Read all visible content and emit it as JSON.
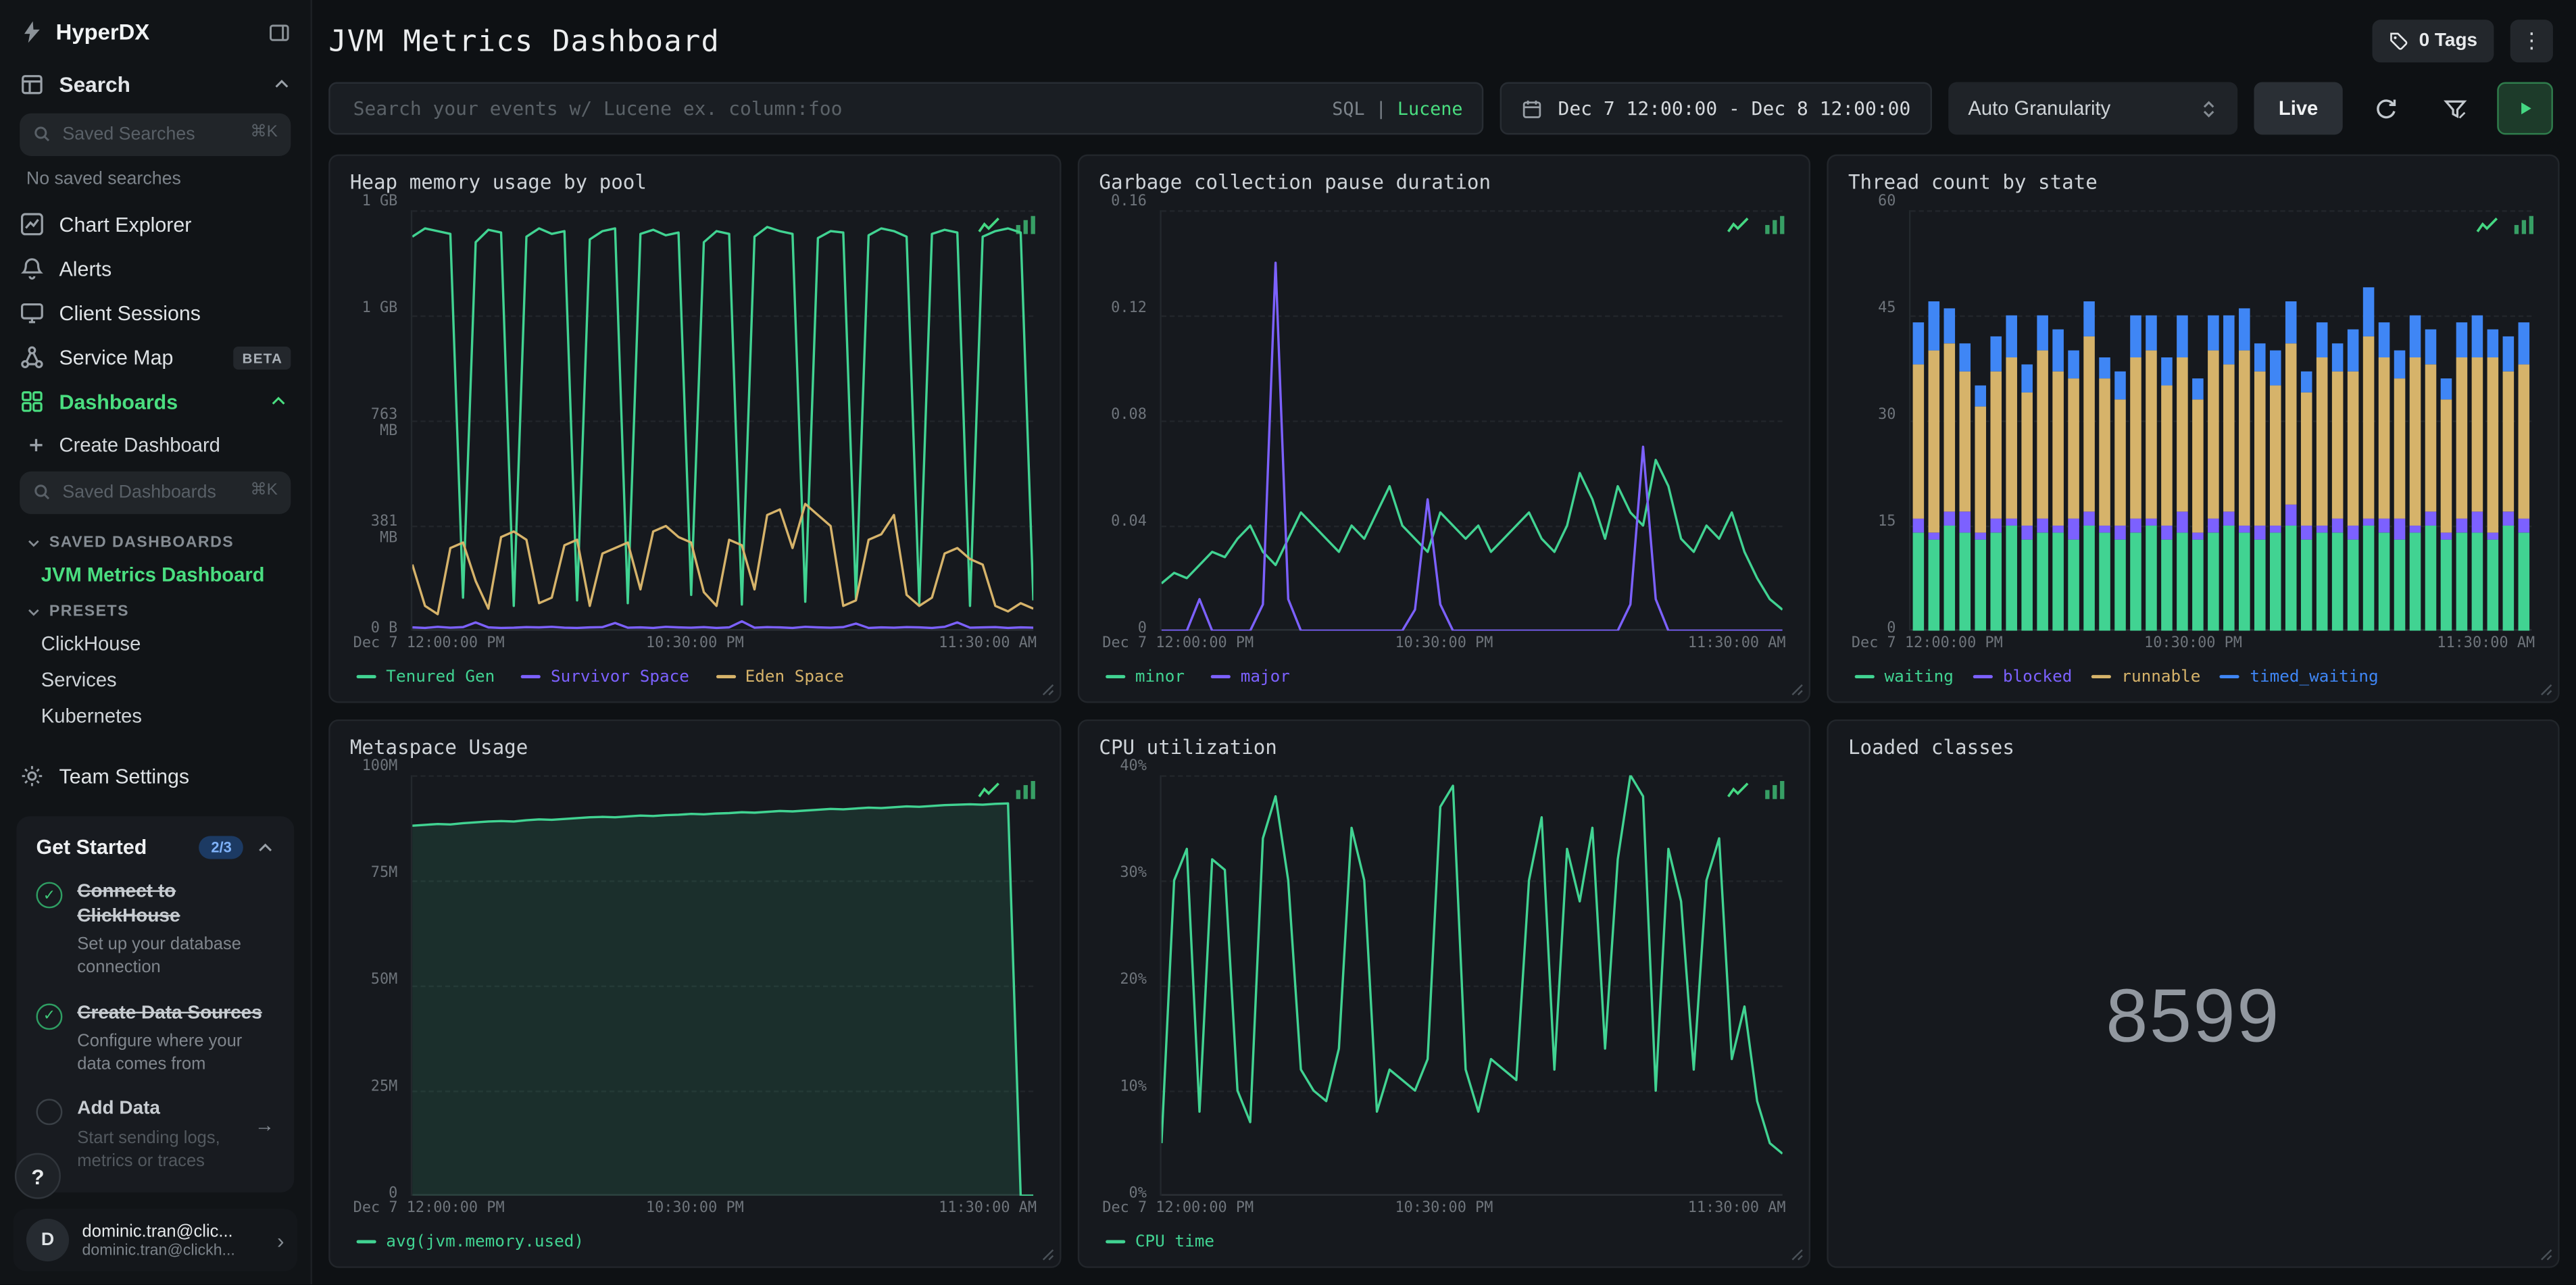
{
  "colors": {
    "accent_green": "#4ade80",
    "series_green": "#41d392",
    "series_purple": "#7c61ff",
    "series_yellow": "#d6b36a",
    "series_blue": "#3f86f5"
  },
  "sidebar": {
    "brand": "HyperDX",
    "search_section_label": "Search",
    "saved_searches": {
      "placeholder": "Saved Searches",
      "shortcut": "⌘K"
    },
    "no_saved_searches": "No saved searches",
    "nav": [
      {
        "label": "Chart Explorer"
      },
      {
        "label": "Alerts"
      },
      {
        "label": "Client Sessions"
      },
      {
        "label": "Service Map",
        "badge": "BETA"
      },
      {
        "label": "Dashboards"
      }
    ],
    "create_dashboard_label": "Create Dashboard",
    "saved_dashboards_input": {
      "placeholder": "Saved Dashboards",
      "shortcut": "⌘K"
    },
    "saved_dashboards_section": "SAVED DASHBOARDS",
    "saved_dashboards": [
      {
        "label": "JVM Metrics Dashboard"
      }
    ],
    "presets_section": "PRESETS",
    "presets": [
      {
        "label": "ClickHouse"
      },
      {
        "label": "Services"
      },
      {
        "label": "Kubernetes"
      }
    ],
    "team_settings_label": "Team Settings",
    "get_started": {
      "title": "Get Started",
      "progress": "2/3",
      "items": [
        {
          "title": "Connect to ClickHouse",
          "subtitle": "Set up your database connection"
        },
        {
          "title": "Create Data Sources",
          "subtitle": "Configure where your data comes from"
        },
        {
          "title": "Add Data",
          "subtitle": "Start sending logs, metrics or traces",
          "arrow": "→"
        }
      ]
    },
    "help_label": "?",
    "user": {
      "initial": "D",
      "name": "dominic.tran@clic...",
      "email": "dominic.tran@clickh...",
      "chevron": "›"
    }
  },
  "header": {
    "title": "JVM Metrics Dashboard",
    "tags_label": "0 Tags",
    "menu_icon": "⋮"
  },
  "toolbar": {
    "search_placeholder": "Search your events w/ Lucene ex. column:foo",
    "mode_sql": "SQL",
    "mode_divider": "|",
    "mode_lucene": "Lucene",
    "date_range": "Dec 7 12:00:00 - Dec 8 12:00:00",
    "granularity": "Auto Granularity",
    "live_label": "Live"
  },
  "chart_data": [
    {
      "id": "heap",
      "title": "Heap memory usage by pool",
      "type": "line",
      "ylim": [
        0,
        1525.9
      ],
      "yticks": [
        {
          "label": "0 B",
          "value": 0
        },
        {
          "label": "381 MB",
          "value": 381.5
        },
        {
          "label": "763 MB",
          "value": 763
        },
        {
          "label": "1 GB",
          "value": 1144.4
        },
        {
          "label": "1 GB",
          "value": 1525.9
        }
      ],
      "x_labels": [
        "Dec 7 12:00:00 PM",
        "10:30:00 PM",
        "11:30:00 AM"
      ],
      "series": [
        {
          "name": "Tenured Gen",
          "color": "#41d392",
          "values": [
            1430,
            1460,
            1450,
            1440,
            120,
            1410,
            1455,
            1445,
            90,
            1430,
            1460,
            1440,
            1450,
            110,
            1420,
            1450,
            1460,
            100,
            1440,
            1455,
            1435,
            1445,
            130,
            1410,
            1450,
            1440,
            95,
            1430,
            1465,
            1450,
            1440,
            105,
            1425,
            1450,
            1445,
            115,
            1435,
            1460,
            1450,
            1430,
            100,
            1440,
            1455,
            1445,
            90,
            1430,
            1450,
            1460,
            1445,
            110
          ]
        },
        {
          "name": "Survivor Space",
          "color": "#7c61ff",
          "values": [
            12,
            10,
            14,
            11,
            13,
            30,
            12,
            10,
            11,
            13,
            12,
            14,
            11,
            10,
            12,
            13,
            28,
            11,
            12,
            10,
            14,
            12,
            11,
            13,
            10,
            12,
            34,
            11,
            13,
            12,
            10,
            14,
            12,
            11,
            13,
            26,
            10,
            12,
            11,
            13,
            12,
            10,
            14,
            30,
            11,
            12,
            13,
            10,
            12,
            11
          ]
        },
        {
          "name": "Eden Space",
          "color": "#d6b36a",
          "values": [
            240,
            90,
            60,
            300,
            320,
            180,
            80,
            340,
            360,
            330,
            100,
            120,
            310,
            330,
            90,
            280,
            300,
            320,
            150,
            360,
            380,
            340,
            320,
            140,
            90,
            330,
            310,
            150,
            420,
            440,
            300,
            460,
            420,
            380,
            90,
            110,
            330,
            350,
            420,
            130,
            90,
            120,
            280,
            300,
            260,
            240,
            90,
            70,
            100,
            80
          ]
        }
      ]
    },
    {
      "id": "gc_pause",
      "title": "Garbage collection pause duration",
      "type": "line",
      "ylim": [
        0,
        0.16
      ],
      "yticks": [
        {
          "label": "0",
          "value": 0
        },
        {
          "label": "0.04",
          "value": 0.04
        },
        {
          "label": "0.08",
          "value": 0.08
        },
        {
          "label": "0.12",
          "value": 0.12
        },
        {
          "label": "0.16",
          "value": 0.16
        }
      ],
      "x_labels": [
        "Dec 7 12:00:00 PM",
        "10:30:00 PM",
        "11:30:00 AM"
      ],
      "series": [
        {
          "name": "minor",
          "color": "#41d392",
          "values": [
            0.018,
            0.022,
            0.02,
            0.025,
            0.03,
            0.028,
            0.035,
            0.04,
            0.03,
            0.025,
            0.035,
            0.045,
            0.04,
            0.035,
            0.03,
            0.04,
            0.035,
            0.045,
            0.055,
            0.04,
            0.035,
            0.03,
            0.045,
            0.04,
            0.035,
            0.04,
            0.03,
            0.035,
            0.04,
            0.045,
            0.035,
            0.03,
            0.04,
            0.06,
            0.05,
            0.035,
            0.055,
            0.045,
            0.04,
            0.065,
            0.055,
            0.035,
            0.03,
            0.04,
            0.035,
            0.045,
            0.03,
            0.02,
            0.012,
            0.008
          ]
        },
        {
          "name": "major",
          "color": "#7c61ff",
          "values": [
            0,
            0,
            0,
            0.012,
            0,
            0,
            0,
            0,
            0.01,
            0.14,
            0.012,
            0,
            0,
            0,
            0,
            0,
            0,
            0,
            0,
            0,
            0.008,
            0.05,
            0.01,
            0,
            0,
            0,
            0,
            0,
            0,
            0,
            0,
            0,
            0,
            0,
            0,
            0,
            0,
            0.01,
            0.07,
            0.012,
            0,
            0,
            0,
            0,
            0,
            0,
            0,
            0,
            0,
            0
          ]
        }
      ]
    },
    {
      "id": "threads",
      "title": "Thread count by state",
      "type": "bar",
      "ylim": [
        0,
        60
      ],
      "yticks": [
        {
          "label": "0",
          "value": 0
        },
        {
          "label": "15",
          "value": 15
        },
        {
          "label": "30",
          "value": 30
        },
        {
          "label": "45",
          "value": 45
        },
        {
          "label": "60",
          "value": 60
        }
      ],
      "x_labels": [
        "Dec 7 12:00:00 PM",
        "10:30:00 PM",
        "11:30:00 AM"
      ],
      "series": [
        {
          "name": "waiting",
          "color": "#41d392",
          "values": [
            14,
            13,
            15,
            14,
            13,
            14,
            15,
            13,
            14,
            14,
            13,
            15,
            14,
            13,
            14,
            15,
            13,
            14,
            13,
            14,
            15,
            14,
            13,
            14,
            15,
            13,
            14,
            14,
            13,
            15,
            14,
            13,
            14,
            15,
            13,
            14,
            14,
            13,
            15,
            14
          ]
        },
        {
          "name": "blocked",
          "color": "#7c61ff",
          "values": [
            2,
            1,
            2,
            3,
            1,
            2,
            1,
            2,
            2,
            1,
            3,
            2,
            1,
            2,
            2,
            1,
            2,
            3,
            1,
            2,
            2,
            1,
            2,
            1,
            3,
            2,
            1,
            2,
            2,
            1,
            2,
            3,
            1,
            2,
            1,
            2,
            3,
            1,
            2,
            2
          ]
        },
        {
          "name": "runnable",
          "color": "#d6b36a",
          "values": [
            22,
            26,
            24,
            20,
            18,
            21,
            23,
            19,
            24,
            22,
            20,
            25,
            21,
            18,
            23,
            24,
            20,
            22,
            19,
            24,
            21,
            25,
            22,
            20,
            23,
            19,
            24,
            21,
            22,
            26,
            23,
            20,
            24,
            21,
            19,
            23,
            22,
            25,
            20,
            22
          ]
        },
        {
          "name": "timed_waiting",
          "color": "#3f86f5",
          "values": [
            6,
            7,
            5,
            4,
            3,
            5,
            6,
            4,
            5,
            6,
            4,
            5,
            3,
            4,
            6,
            5,
            4,
            6,
            3,
            5,
            7,
            6,
            4,
            5,
            6,
            3,
            5,
            4,
            6,
            7,
            5,
            4,
            6,
            5,
            3,
            5,
            6,
            4,
            5,
            6
          ]
        }
      ]
    },
    {
      "id": "metaspace",
      "title": "Metaspace Usage",
      "type": "line",
      "ylim": [
        0,
        100
      ],
      "yticks": [
        {
          "label": "0",
          "value": 0
        },
        {
          "label": "25M",
          "value": 25
        },
        {
          "label": "50M",
          "value": 50
        },
        {
          "label": "75M",
          "value": 75
        },
        {
          "label": "100M",
          "value": 100
        }
      ],
      "x_labels": [
        "Dec 7 12:00:00 PM",
        "10:30:00 PM",
        "11:30:00 AM"
      ],
      "series": [
        {
          "name": "avg(jvm.memory.used)",
          "color": "#41d392",
          "area": true,
          "values": [
            88,
            88.2,
            88.4,
            88.3,
            88.6,
            88.8,
            89,
            89.1,
            89,
            89.3,
            89.5,
            89.4,
            89.6,
            89.8,
            90,
            90.1,
            90,
            90.2,
            90.4,
            90.3,
            90.5,
            90.6,
            90.8,
            90.7,
            90.9,
            91,
            91.2,
            91.1,
            91.3,
            91.5,
            91.4,
            91.6,
            91.8,
            92,
            91.9,
            92.1,
            92.3,
            92.2,
            92.4,
            92.6,
            92.5,
            92.7,
            92.9,
            93,
            93.1,
            93,
            93.2,
            93.3,
            0,
            0
          ]
        }
      ]
    },
    {
      "id": "cpu",
      "title": "CPU utilization",
      "type": "line",
      "ylim": [
        0,
        40
      ],
      "yticks": [
        {
          "label": "0%",
          "value": 0
        },
        {
          "label": "10%",
          "value": 10
        },
        {
          "label": "20%",
          "value": 20
        },
        {
          "label": "30%",
          "value": 30
        },
        {
          "label": "40%",
          "value": 40
        }
      ],
      "x_labels": [
        "Dec 7 12:00:00 PM",
        "10:30:00 PM",
        "11:30:00 AM"
      ],
      "series": [
        {
          "name": "CPU time",
          "color": "#41d392",
          "values": [
            5,
            30,
            33,
            8,
            32,
            31,
            10,
            7,
            34,
            38,
            30,
            12,
            10,
            9,
            14,
            35,
            30,
            8,
            12,
            11,
            10,
            13,
            37,
            39,
            12,
            8,
            13,
            12,
            11,
            30,
            36,
            12,
            33,
            28,
            35,
            14,
            32,
            40,
            38,
            10,
            33,
            28,
            12,
            30,
            34,
            13,
            18,
            9,
            5,
            4
          ]
        }
      ]
    },
    {
      "id": "loaded_classes",
      "title": "Loaded classes",
      "type": "number",
      "value": "8599"
    }
  ]
}
